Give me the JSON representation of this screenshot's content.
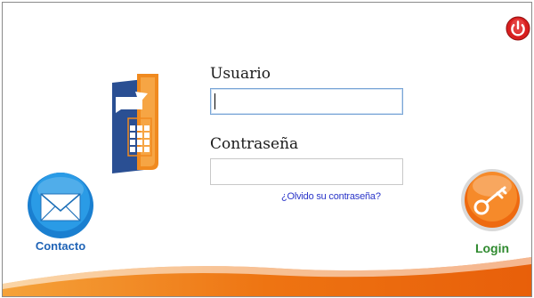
{
  "form": {
    "username_label": "Usuario",
    "username_value": "",
    "password_label": "Contraseña",
    "password_value": "",
    "forgot_password_link": "¿Olvido su contraseña?"
  },
  "buttons": {
    "contact_label": "Contacto",
    "login_label": "Login",
    "power_icon": "power-icon"
  },
  "colors": {
    "accent_orange": "#f07a12",
    "contact_blue": "#1f63b6",
    "login_green": "#2f8a2f",
    "link_blue": "#2a35c9",
    "power_red": "#d81f1f"
  }
}
